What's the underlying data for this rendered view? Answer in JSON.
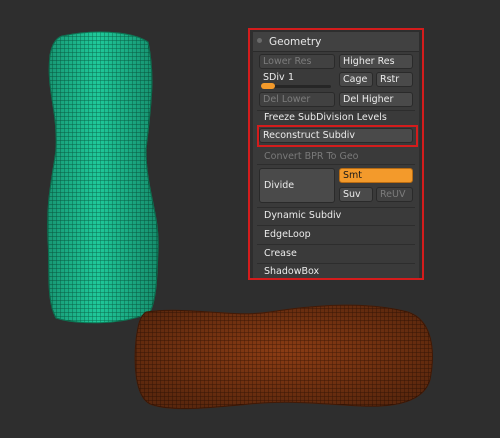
{
  "panel": {
    "title": "Geometry",
    "lower_res": "Lower Res",
    "higher_res": "Higher Res",
    "sdiv_label": "SDiv",
    "sdiv_value": "1",
    "cage": "Cage",
    "rstr": "Rstr",
    "del_lower": "Del Lower",
    "del_higher": "Del Higher",
    "freeze_subdivision": "Freeze SubDivision Levels",
    "reconstruct_subdiv": "Reconstruct Subdiv",
    "convert_bpr": "Convert BPR To Geo",
    "divide": "Divide",
    "smt": "Smt",
    "suv": "Suv",
    "reuv": "ReUV",
    "dynamic_subdiv": "Dynamic Subdiv",
    "edgeloop": "EdgeLoop",
    "crease": "Crease",
    "shadowbox": "ShadowBox"
  },
  "colors": {
    "background": "#2e2e2e",
    "highlight_outline": "#d41c1c",
    "accent": "#f39a2b",
    "mesh_green": "#1fc99a",
    "mesh_brown": "#8a3c14"
  }
}
